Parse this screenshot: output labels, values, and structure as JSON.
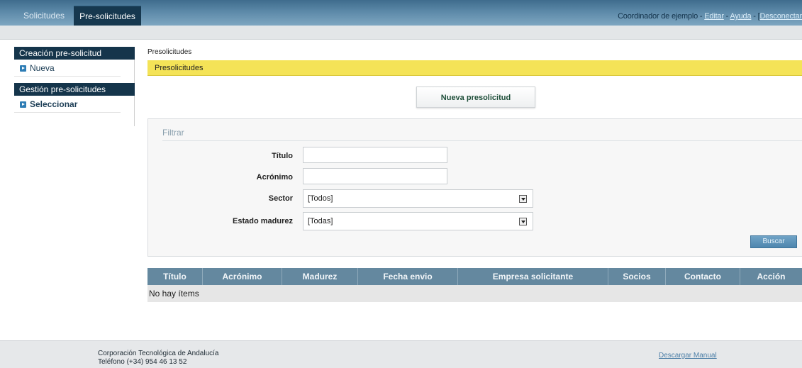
{
  "topbar": {
    "tabs": [
      {
        "label": "Solicitudes"
      },
      {
        "label": "Pre-solicitudes"
      }
    ],
    "user_text": "Coordinador de ejemplo",
    "sep1": " - ",
    "edit_label": "Editar",
    "sep2": " - ",
    "help_label": "Ayuda",
    "sep3": " - [",
    "logout_label": "Desconectar"
  },
  "sidebar": {
    "sections": [
      {
        "title": "Creación pre-solicitud",
        "items": [
          {
            "label": "Nueva"
          }
        ]
      },
      {
        "title": "Gestión pre-solicitudes",
        "items": [
          {
            "label": "Seleccionar"
          }
        ]
      }
    ]
  },
  "main": {
    "breadcrumb": "Presolicitudes",
    "section_title": "Presolicitudes",
    "new_button": "Nueva presolicitud"
  },
  "filter": {
    "title": "Filtrar",
    "fields": {
      "titulo": {
        "label": "Título",
        "value": ""
      },
      "acronimo": {
        "label": "Acrónimo",
        "value": ""
      },
      "sector": {
        "label": "Sector",
        "value": "[Todos]"
      },
      "estado": {
        "label": "Estado madurez",
        "value": "[Todas]"
      }
    },
    "search_button": "Buscar"
  },
  "table": {
    "columns": [
      "Título",
      "Acrónimo",
      "Madurez",
      "Fecha envio",
      "Empresa solicitante",
      "Socios",
      "Contacto",
      "Acción"
    ],
    "empty_text": "No hay ítems"
  },
  "footer": {
    "company": "Corporación Tecnológica de Andalucía",
    "phone": "Teléfono (+34) 954 46 13 52",
    "manual_link": "Descargar Manual"
  },
  "colors": {
    "topbar": "#5c89a8",
    "sidebar_header": "#15354b",
    "highlight_bar": "#f4e357",
    "table_header": "#64889f",
    "search_button": "#4e86ae"
  },
  "icons": {
    "sidebar_item_icon": "arrow-bullet-icon",
    "select_icon": "chevron-down-icon"
  }
}
